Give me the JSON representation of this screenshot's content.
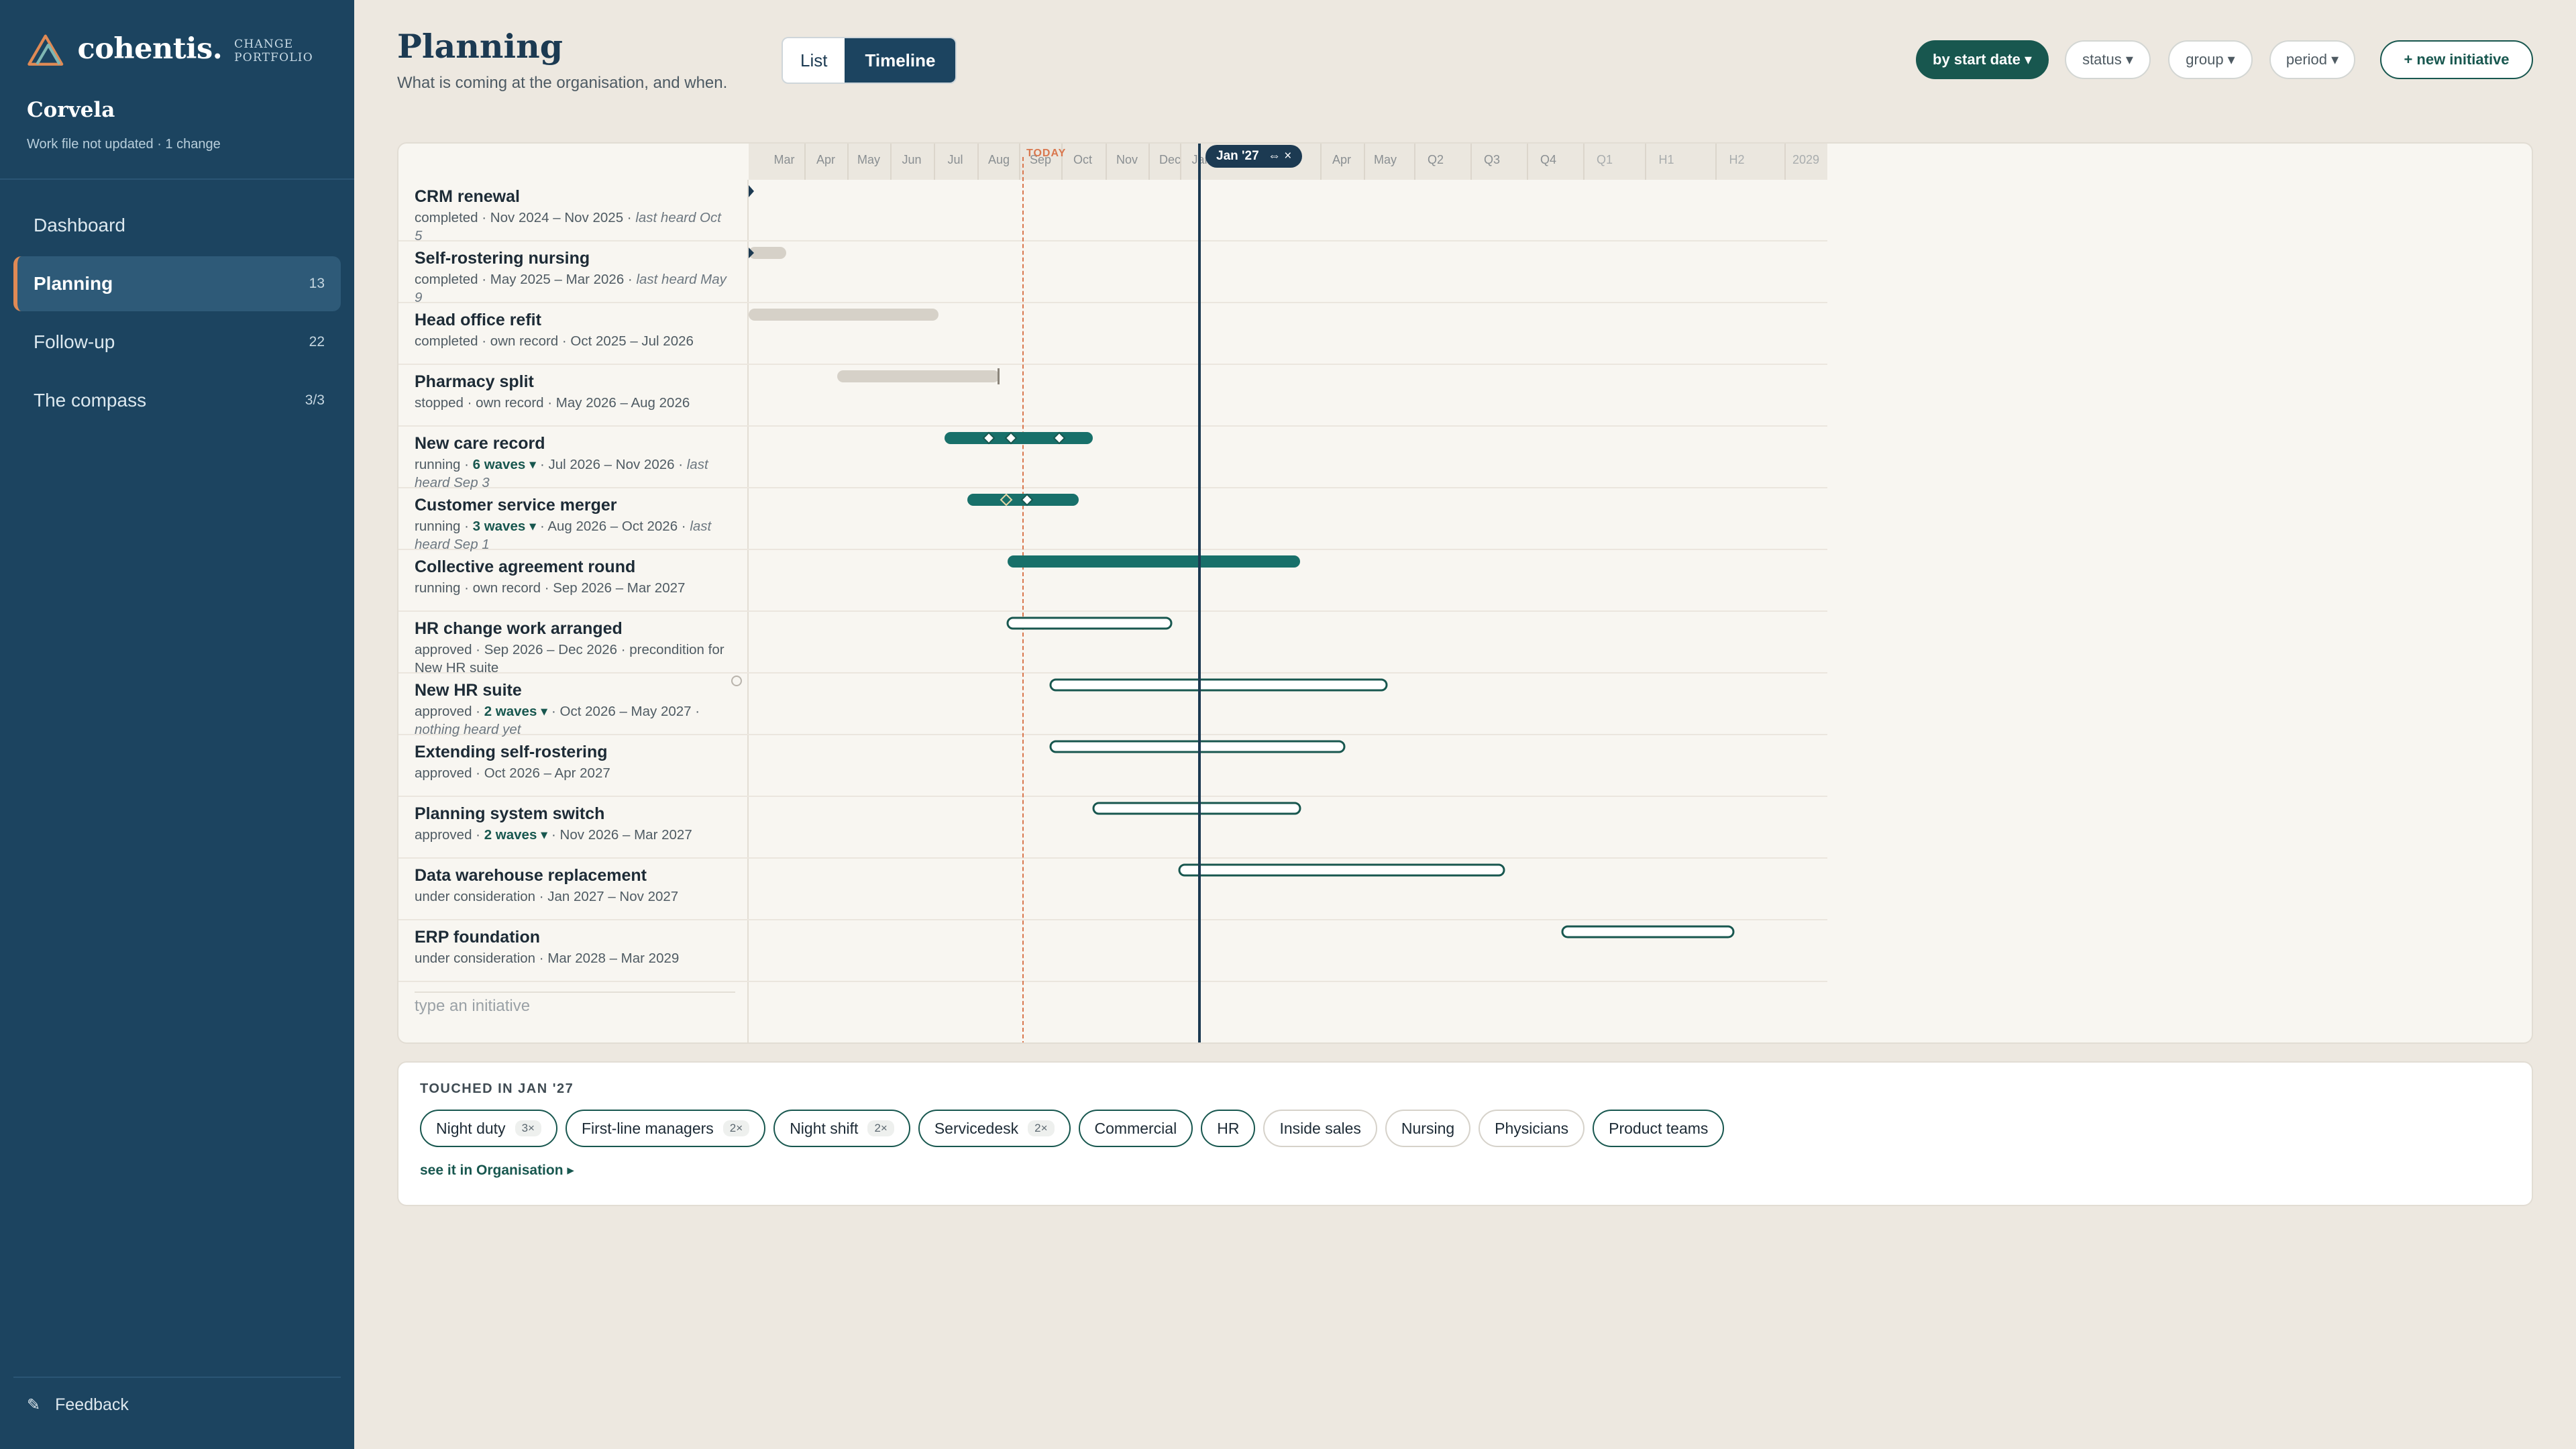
{
  "brand": {
    "name": "cohentis.",
    "sub": "CHANGE PORTFOLIO"
  },
  "org": {
    "name": "Corvela",
    "status": "Work file not updated · 1 change"
  },
  "nav": [
    {
      "label": "Dashboard",
      "count": ""
    },
    {
      "label": "Planning",
      "count": "13"
    },
    {
      "label": "Follow-up",
      "count": "22"
    },
    {
      "label": "The compass",
      "count": "3/3"
    }
  ],
  "feedback": "Feedback",
  "header": {
    "title": "Planning",
    "subtitle": "What is coming at the organisation, and when.",
    "view_list": "List",
    "view_timeline": "Timeline",
    "sort": "by start date ▾",
    "status": "status ▾",
    "group": "group ▾",
    "period": "period ▾",
    "new": "+ new initiative"
  },
  "timeline": {
    "ticks": [
      "Mar",
      "Apr",
      "May",
      "Jun",
      "Jul",
      "Aug",
      "Sep",
      "Oct",
      "Nov",
      "Dec",
      "Jan",
      "Apr",
      "May",
      "Q2",
      "Q3",
      "Q4",
      "Q1",
      "H1",
      "H2",
      "2029"
    ],
    "today_label": "TODAY",
    "selected_label": "Jan '27",
    "selected_icons": "⇔  ×",
    "type_placeholder": "type an initiative"
  },
  "rows": [
    {
      "name": "CRM renewal",
      "meta_a": "completed · Nov 2024 – Nov 2025",
      "waves": "",
      "meta_b": "",
      "heard": "last heard Oct 5",
      "kind": "arrow"
    },
    {
      "name": "Self-rostering nursing",
      "meta_a": "completed · May 2025 – Mar 2026",
      "waves": "",
      "meta_b": "",
      "heard": "last heard May 9",
      "kind": "done"
    },
    {
      "name": "Head office refit",
      "meta_a": "completed · own record · Oct 2025 – Jul 2026",
      "waves": "",
      "meta_b": "",
      "heard": "",
      "kind": "done"
    },
    {
      "name": "Pharmacy split",
      "meta_a": "stopped · own record · May 2026 – Aug 2026",
      "waves": "",
      "meta_b": "",
      "heard": "",
      "kind": "stopped"
    },
    {
      "name": "New care record",
      "meta_a": "running · ",
      "waves": "6 waves ▾",
      "meta_b": " · Jul 2026 – Nov 2026",
      "heard": "last heard Sep 3",
      "kind": "running"
    },
    {
      "name": "Customer service merger",
      "meta_a": "running · ",
      "waves": "3 waves ▾",
      "meta_b": " · Aug 2026 – Oct 2026",
      "heard": "last heard Sep 1",
      "kind": "running"
    },
    {
      "name": "Collective agreement round",
      "meta_a": "running · own record · Sep 2026 – Mar 2027",
      "waves": "",
      "meta_b": "",
      "heard": "",
      "kind": "running"
    },
    {
      "name": "HR change work arranged",
      "meta_a": "approved · Sep 2026 – Dec 2026 · precondition for New HR suite",
      "waves": "",
      "meta_b": "",
      "heard": "",
      "kind": "approved"
    },
    {
      "name": "New HR suite",
      "meta_a": "approved · ",
      "waves": "2 waves ▾",
      "meta_b": " · Oct 2026 – May 2027",
      "heard": "nothing heard yet",
      "kind": "approved"
    },
    {
      "name": "Extending self-rostering",
      "meta_a": "approved · Oct 2026 – Apr 2027",
      "waves": "",
      "meta_b": "",
      "heard": "",
      "kind": "approved"
    },
    {
      "name": "Planning system switch",
      "meta_a": "approved · ",
      "waves": "2 waves ▾",
      "meta_b": " · Nov 2026 – Mar 2027",
      "heard": "",
      "kind": "approved"
    },
    {
      "name": "Data warehouse replacement",
      "meta_a": "under consideration · Jan 2027 – Nov 2027",
      "waves": "",
      "meta_b": "",
      "heard": "",
      "kind": "consider"
    },
    {
      "name": "ERP foundation",
      "meta_a": "under consideration · Mar 2028 – Mar 2029",
      "waves": "",
      "meta_b": "",
      "heard": "",
      "kind": "consider"
    }
  ],
  "touched": {
    "title": "TOUCHED IN JAN '27",
    "tags": [
      {
        "label": "Night duty",
        "count": "3×",
        "accent": true
      },
      {
        "label": "First-line managers",
        "count": "2×",
        "accent": true
      },
      {
        "label": "Night shift",
        "count": "2×",
        "accent": true
      },
      {
        "label": "Servicedesk",
        "count": "2×",
        "accent": true
      },
      {
        "label": "Commercial",
        "count": "",
        "accent": true
      },
      {
        "label": "HR",
        "count": "",
        "accent": true
      },
      {
        "label": "Inside sales",
        "count": "",
        "accent": false
      },
      {
        "label": "Nursing",
        "count": "",
        "accent": false
      },
      {
        "label": "Physicians",
        "count": "",
        "accent": false
      },
      {
        "label": "Product teams",
        "count": "",
        "accent": true
      }
    ],
    "link": "see it in Organisation ▸"
  },
  "colors": {
    "sidebar": "#1c4460",
    "accent": "#18574f",
    "running": "#18706a",
    "done": "#d6d1c8",
    "today": "#d9774e"
  }
}
